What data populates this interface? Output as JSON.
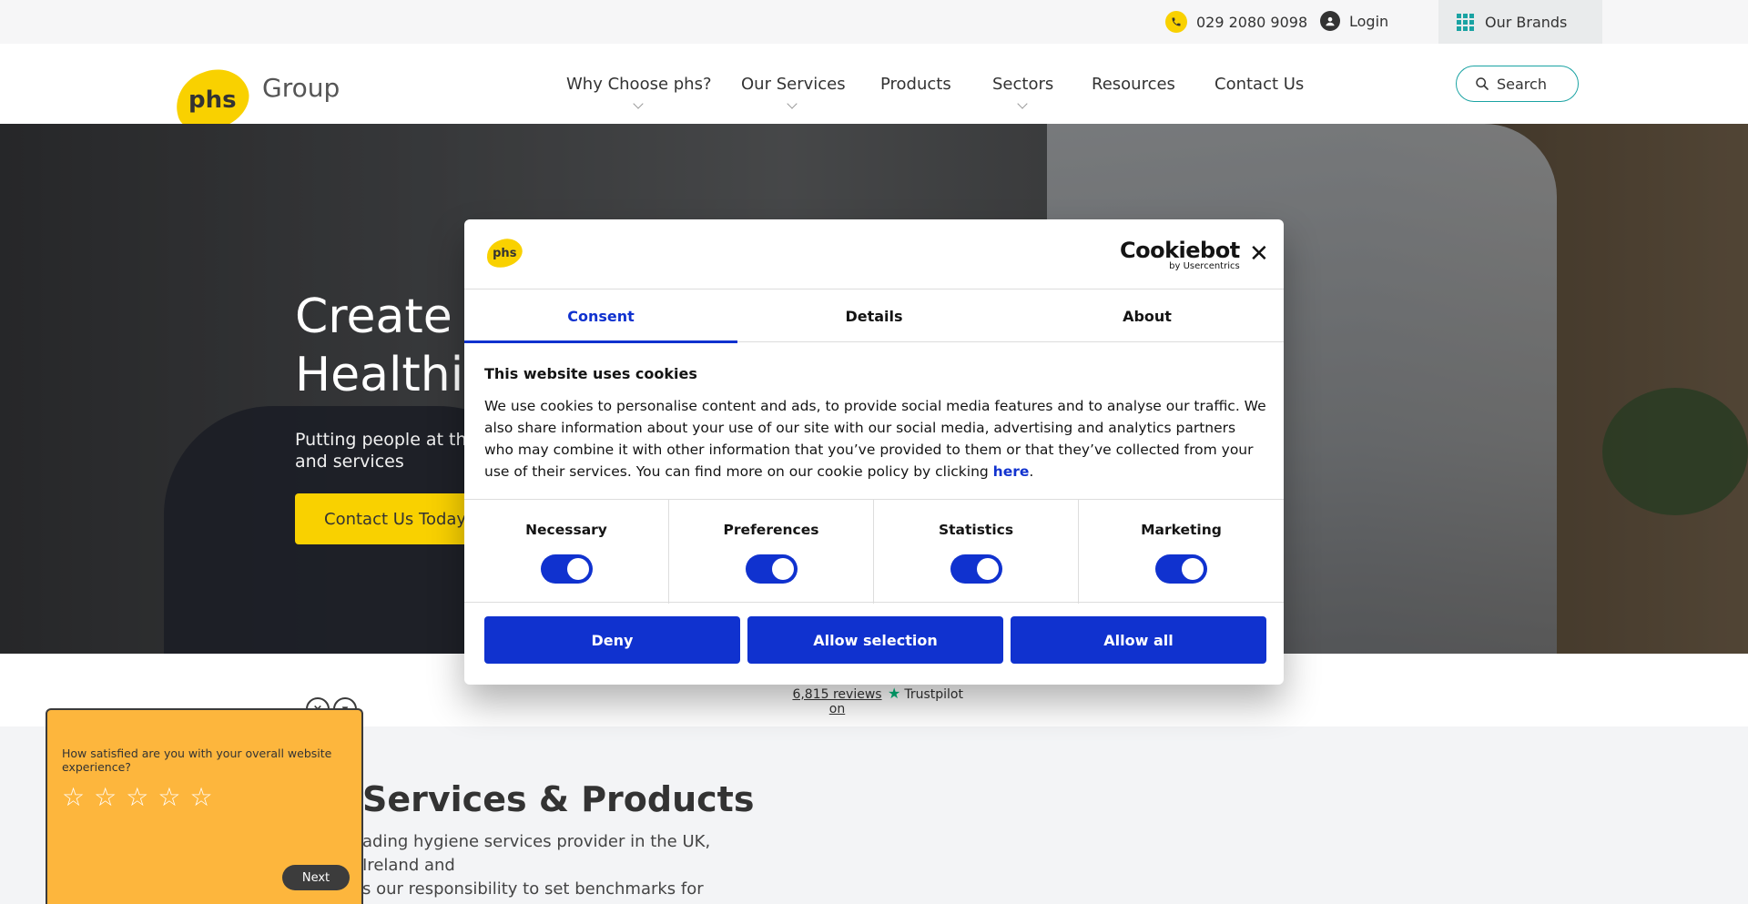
{
  "topbar": {
    "phone": "029 2080 9098",
    "login": "Login",
    "brands": "Our Brands"
  },
  "header": {
    "logo_mark": "phs",
    "logo_text": "Group",
    "nav": [
      {
        "label": "Why Choose phs?",
        "dropdown": true
      },
      {
        "label": "Our Services",
        "dropdown": true
      },
      {
        "label": "Products",
        "dropdown": false
      },
      {
        "label": "Sectors",
        "dropdown": true
      },
      {
        "label": "Resources",
        "dropdown": false
      },
      {
        "label": "Contact Us",
        "dropdown": false
      }
    ],
    "search": "Search"
  },
  "hero": {
    "title_line1": "Create",
    "title_line2": "Healthi",
    "subtitle": "Putting people at the\nand services",
    "cta": "Contact Us Today"
  },
  "trustpilot": {
    "reviews": "6,815 reviews on",
    "brand": "Trustpilot",
    "star_color": "#00b67a"
  },
  "section": {
    "title": "Services & Products",
    "body": "ading hygiene services provider in the UK, Ireland and\ns our responsibility to set benchmarks for standards,\nhange and to innovate."
  },
  "survey": {
    "question": "How satisfied are you with your overall website experience?",
    "stars": 5,
    "next": "Next",
    "close_glyph": "×",
    "minimize_glyph": "▾"
  },
  "cookie": {
    "logo_mark": "phs",
    "brand_main": "Cookiebot",
    "brand_sub": "by Usercentrics",
    "close_glyph": "✕",
    "tabs": [
      {
        "label": "Consent",
        "active": true
      },
      {
        "label": "Details",
        "active": false
      },
      {
        "label": "About",
        "active": false
      }
    ],
    "heading": "This website uses cookies",
    "text": "We use cookies to personalise content and ads, to provide social media features and to analyse our traffic. We also share information about your use of our site with our social media, advertising and analytics partners who may combine it with other information that you’ve provided to them or that they’ve collected from your use of their services. You can find more on our cookie policy by clicking ",
    "link": "here",
    "link_suffix": ".",
    "toggles": [
      {
        "label": "Necessary",
        "on": true
      },
      {
        "label": "Preferences",
        "on": true
      },
      {
        "label": "Statistics",
        "on": true
      },
      {
        "label": "Marketing",
        "on": true
      }
    ],
    "buttons": {
      "deny": "Deny",
      "allow_selection": "Allow selection",
      "allow_all": "Allow all"
    },
    "accent": "#1032cf"
  },
  "colors": {
    "brand_yellow": "#f9d100",
    "teal": "#1aa3a3",
    "survey_orange": "#fdb63d"
  }
}
